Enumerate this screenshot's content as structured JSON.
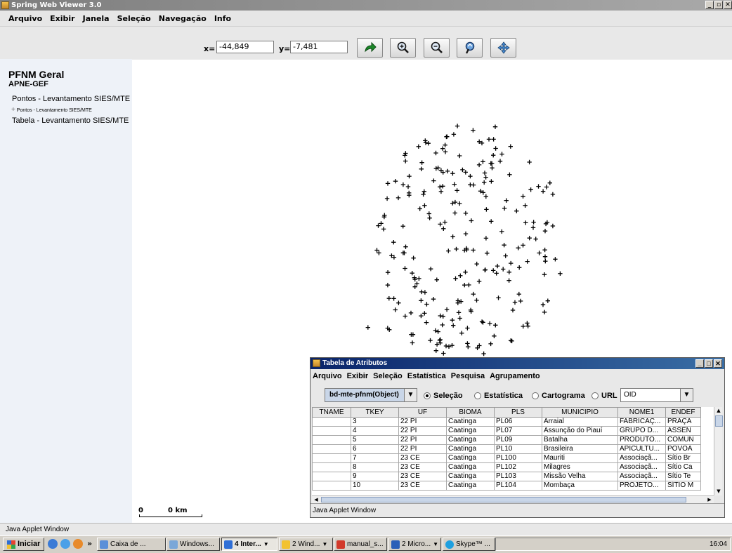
{
  "window": {
    "title": "Spring Web Viewer 3.0",
    "controls": [
      "_",
      "▫",
      "✕"
    ]
  },
  "menubar": [
    "Arquivo",
    "Exibir",
    "Janela",
    "Seleção",
    "Navegação",
    "Info"
  ],
  "toolbar": {
    "x_label": "x=",
    "x_value": "-44,849",
    "y_label": "y=",
    "y_value": "-7,481",
    "buttons": [
      "redo-icon",
      "zoom-in-icon",
      "zoom-out-icon",
      "zoom-previous-icon",
      "pan-icon"
    ]
  },
  "sidebar": {
    "title": "PFNM Geral",
    "subtitle": "APNE-GEF",
    "layers": [
      {
        "label": "Pontos - Levantamento SIES/MTE"
      },
      {
        "label": "Pontos - Levantamento SIES/MTE",
        "legend": true
      },
      {
        "label": "Tabela - Levantamento SIES/MTE"
      }
    ]
  },
  "scalebar": {
    "left": "0",
    "right": "0 km"
  },
  "status": "Java Applet Window",
  "attr_window": {
    "title": "Tabela de Atributos",
    "controls": [
      "_",
      "□",
      "✕"
    ],
    "menu": [
      "Arquivo",
      "Exibir",
      "Seleção",
      "Estatística",
      "Pesquisa",
      "Agrupamento"
    ],
    "object_combo": "bd-mte-pfnm(Object)",
    "modes": [
      {
        "label": "Seleção",
        "selected": true
      },
      {
        "label": "Estatística",
        "selected": false
      },
      {
        "label": "Cartograma",
        "selected": false
      },
      {
        "label": "URL",
        "selected": false
      }
    ],
    "field_combo": "OID",
    "columns": [
      "TNAME",
      "TKEY",
      "UF",
      "BIOMA",
      "PLS",
      "MUNICIPIO",
      "NOME1",
      "ENDEF"
    ],
    "rows": [
      [
        "",
        "3",
        "22 PI",
        "Caatinga",
        "PL06",
        "Arraial",
        "FABRICAÇ...",
        "PRAÇA"
      ],
      [
        "",
        "4",
        "22 PI",
        "Caatinga",
        "PL07",
        "Assunção do Piauí",
        "GRUPO D...",
        "ASSEN"
      ],
      [
        "",
        "5",
        "22 PI",
        "Caatinga",
        "PL09",
        "Batalha",
        "PRODUTO...",
        "COMUN"
      ],
      [
        "",
        "6",
        "22 PI",
        "Caatinga",
        "PL10",
        "Brasileira",
        "APICULTU...",
        "POVOA"
      ],
      [
        "",
        "7",
        "23 CE",
        "Caatinga",
        "PL100",
        "Mauriti",
        "Associaçã...",
        "Sítio Br"
      ],
      [
        "",
        "8",
        "23 CE",
        "Caatinga",
        "PL102",
        "Milagres",
        "Associaçã...",
        "Sítio Ca"
      ],
      [
        "",
        "9",
        "23 CE",
        "Caatinga",
        "PL103",
        "Missão Velha",
        "Associaçã...",
        "Sítio Te"
      ],
      [
        "",
        "10",
        "23 CE",
        "Caatinga",
        "PL104",
        "Mombaça",
        "PROJETO...",
        "SÍTIO M"
      ]
    ],
    "status": "Java Applet Window"
  },
  "taskbar": {
    "start": "Iniciar",
    "items": [
      {
        "label": "Caixa de ...",
        "active": false
      },
      {
        "label": "Windows...",
        "active": false
      },
      {
        "label": "4 Inter...",
        "active": true
      },
      {
        "label": "2 Wind...",
        "active": false
      },
      {
        "label": "manual_s...",
        "active": false
      },
      {
        "label": "2 Micro...",
        "active": false
      },
      {
        "label": "Skype™ ...",
        "active": false
      }
    ],
    "clock": "16:04"
  }
}
